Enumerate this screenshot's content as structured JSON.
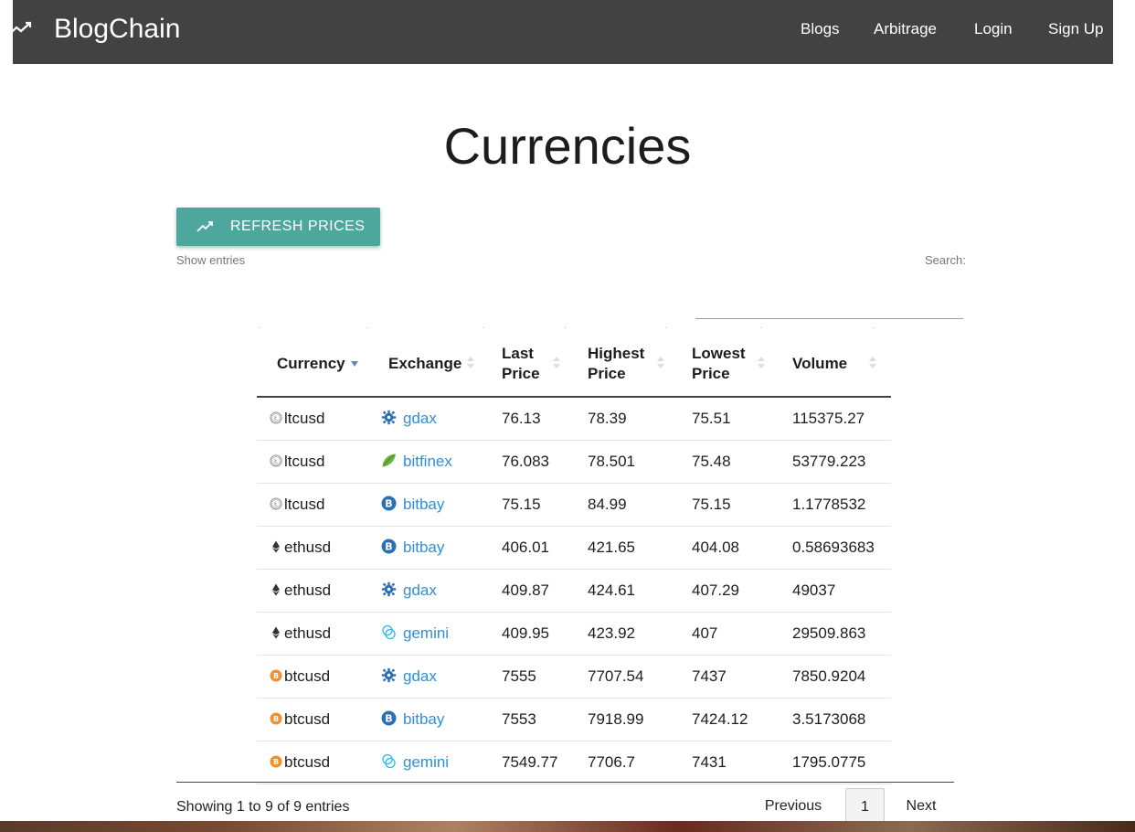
{
  "navbar": {
    "brand": "BlogChain",
    "links": [
      {
        "label": "Blogs"
      },
      {
        "label": "Arbitrage"
      },
      {
        "label": "Login"
      },
      {
        "label": "Sign Up"
      }
    ]
  },
  "page": {
    "title": "Currencies",
    "refresh_button": "REFRESH PRICES",
    "show_entries": "Show entries",
    "search_label": "Search:",
    "search_value": ""
  },
  "table": {
    "headers": [
      "Currency",
      "Exchange",
      "Last Price",
      "Highest Price",
      "Lowest Price",
      "Volume"
    ],
    "sorted_column": "Currency",
    "sort_direction": "descending",
    "rows": [
      {
        "currency": "ltcusd",
        "coin": "litecoin-icon",
        "exchange": "gdax",
        "exchange_icon": "gdax-icon",
        "last": "76.13",
        "high": "78.39",
        "low": "75.51",
        "volume": "115375.27"
      },
      {
        "currency": "ltcusd",
        "coin": "litecoin-icon",
        "exchange": "bitfinex",
        "exchange_icon": "bitfinex-icon",
        "last": "76.083",
        "high": "78.501",
        "low": "75.48",
        "volume": "53779.223"
      },
      {
        "currency": "ltcusd",
        "coin": "litecoin-icon",
        "exchange": "bitbay",
        "exchange_icon": "bitbay-icon",
        "last": "75.15",
        "high": "84.99",
        "low": "75.15",
        "volume": "1.1778532"
      },
      {
        "currency": "ethusd",
        "coin": "ethereum-icon",
        "exchange": "bitbay",
        "exchange_icon": "bitbay-icon",
        "last": "406.01",
        "high": "421.65",
        "low": "404.08",
        "volume": "0.58693683"
      },
      {
        "currency": "ethusd",
        "coin": "ethereum-icon",
        "exchange": "gdax",
        "exchange_icon": "gdax-icon",
        "last": "409.87",
        "high": "424.61",
        "low": "407.29",
        "volume": "49037"
      },
      {
        "currency": "ethusd",
        "coin": "ethereum-icon",
        "exchange": "gemini",
        "exchange_icon": "gemini-icon",
        "last": "409.95",
        "high": "423.92",
        "low": "407",
        "volume": "29509.863"
      },
      {
        "currency": "btcusd",
        "coin": "bitcoin-icon",
        "exchange": "gdax",
        "exchange_icon": "gdax-icon",
        "last": "7555",
        "high": "7707.54",
        "low": "7437",
        "volume": "7850.9204"
      },
      {
        "currency": "btcusd",
        "coin": "bitcoin-icon",
        "exchange": "bitbay",
        "exchange_icon": "bitbay-icon",
        "last": "7553",
        "high": "7918.99",
        "low": "7424.12",
        "volume": "3.5173068"
      },
      {
        "currency": "btcusd",
        "coin": "bitcoin-icon",
        "exchange": "gemini",
        "exchange_icon": "gemini-icon",
        "last": "7549.77",
        "high": "7706.7",
        "low": "7431",
        "volume": "1795.0775"
      }
    ]
  },
  "pagination": {
    "info": "Showing 1 to 9 of 9 entries",
    "previous": "Previous",
    "current": "1",
    "next": "Next"
  },
  "colors": {
    "navbar": "#424242",
    "button": "#4ea79c",
    "link": "#2f8fd8",
    "sort_active": "#6d7fcc",
    "bitcoin": "#f0912f"
  }
}
